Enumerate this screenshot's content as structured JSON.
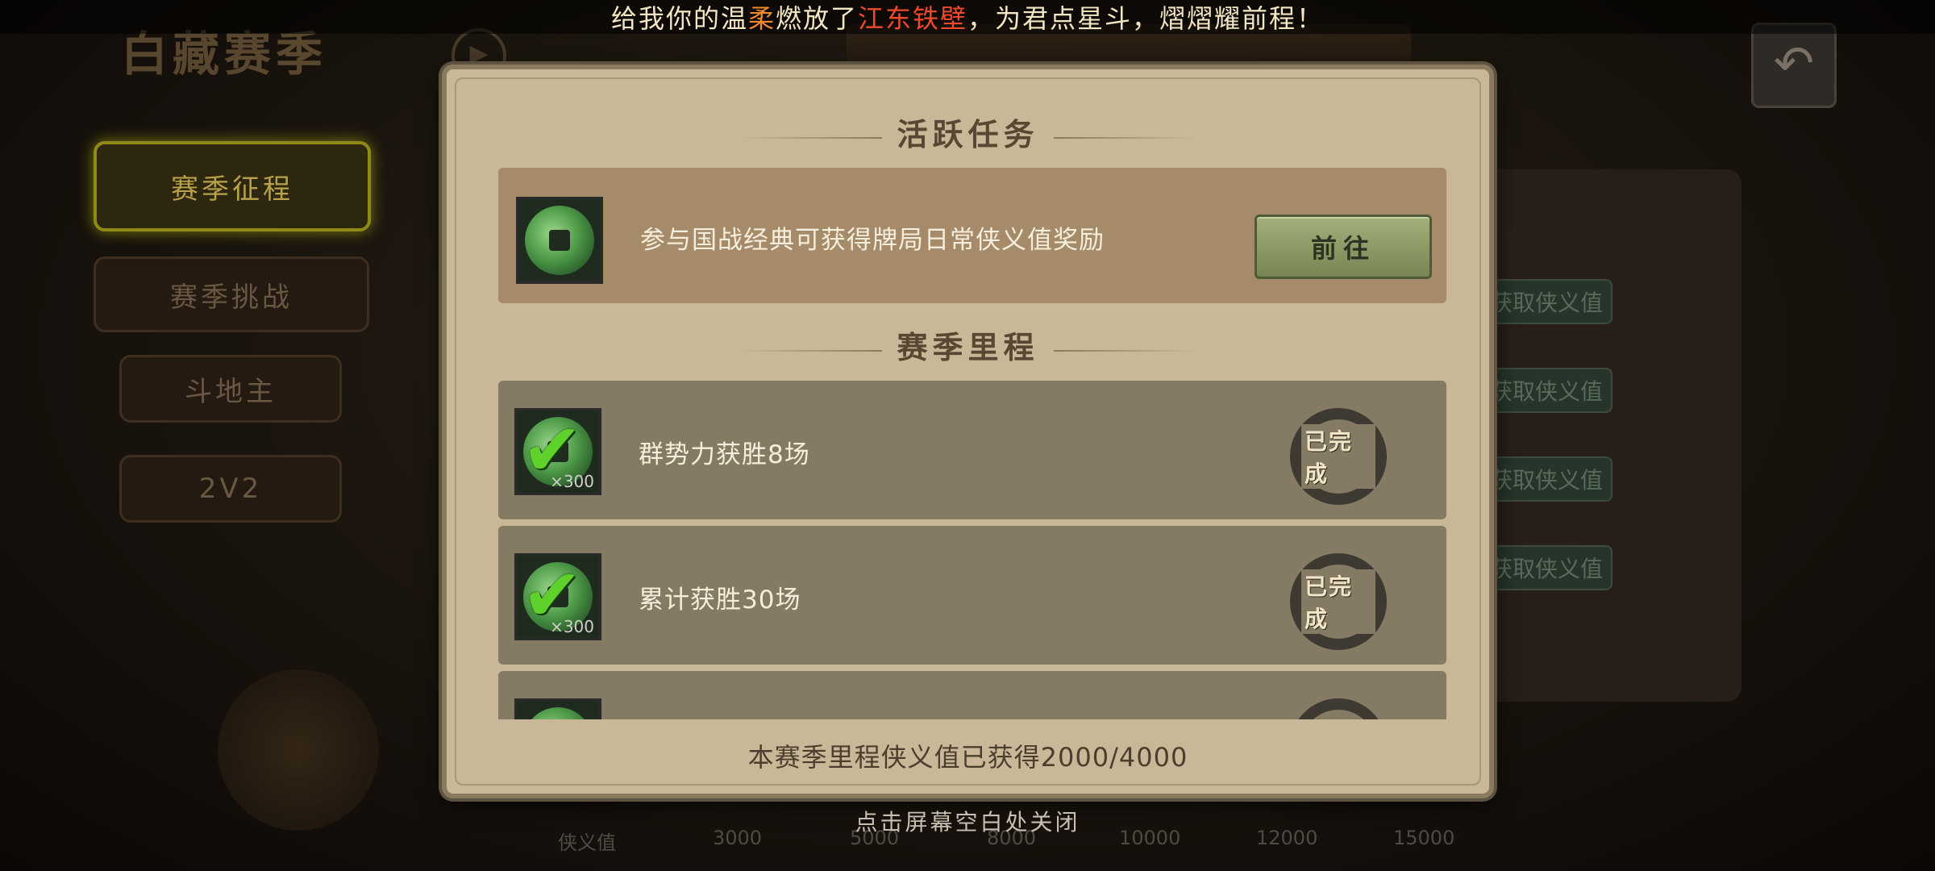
{
  "marquee": {
    "prefix": "给我你的温",
    "name": "柔",
    "middle": "燃放了",
    "title": "江东铁壁",
    "suffix": "，为君点星斗，熠熠耀前程！"
  },
  "background": {
    "season_title": "白藏赛季",
    "side_menu": [
      {
        "label": "赛季征程",
        "active": true
      },
      {
        "label": "赛季挑战",
        "active": false
      },
      {
        "label": "斗地主",
        "active": false
      },
      {
        "label": "2V2",
        "active": false
      }
    ],
    "right_buttons": [
      "获取侠义值",
      "获取侠义值",
      "获取侠义值",
      "获取侠义值"
    ],
    "bottom_thresholds": [
      "侠义值",
      "3000",
      "5000",
      "8000",
      "10000",
      "12000",
      "15000"
    ]
  },
  "dialog": {
    "active_section_title": "活跃任务",
    "active_task": {
      "text": "参与国战经典可获得牌局日常侠义值奖励",
      "button_label": "前往"
    },
    "milestone_section_title": "赛季里程",
    "milestones": [
      {
        "text": "群势力获胜8场",
        "quantity": "×300",
        "status": "已完成"
      },
      {
        "text": "累计获胜30场",
        "quantity": "×300",
        "status": "已完成"
      },
      {
        "text": "",
        "quantity": "",
        "status": ""
      }
    ],
    "progress_text": "本赛季里程侠义值已获得2000/4000"
  },
  "close_hint": "点击屏幕空白处关闭"
}
